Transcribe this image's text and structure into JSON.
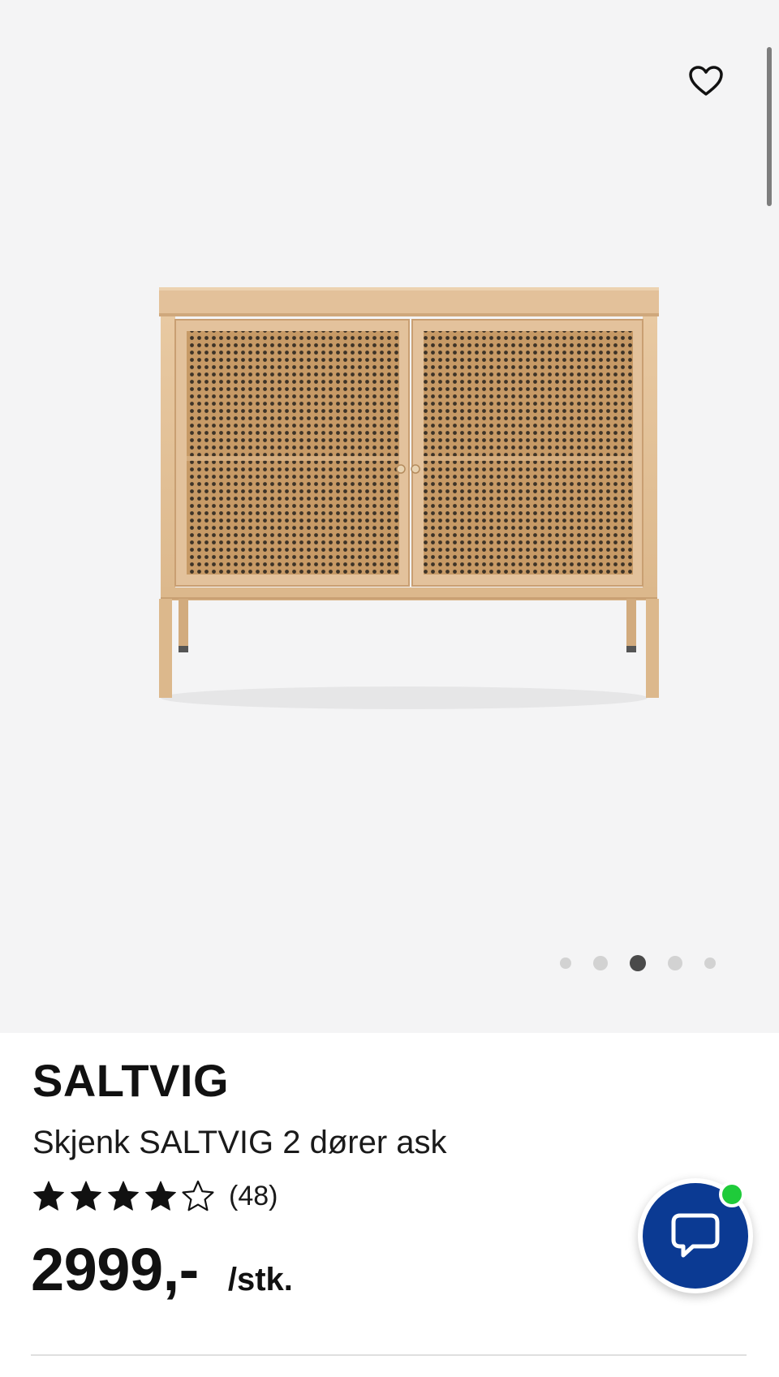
{
  "gallery": {
    "image_alt": "Skjenk SALTVIG 2 dører ask",
    "wishlist_icon": "heart-outline-icon",
    "dot_count": 5,
    "active_dot_index": 2,
    "colors": {
      "background": "#f4f4f5",
      "dot_active": "#4a4a4a",
      "dot_inactive": "#d2d2d2"
    }
  },
  "product": {
    "brand": "SALTVIG",
    "description": "Skjenk SALTVIG 2 dører ask",
    "rating": {
      "value": 4,
      "max": 5,
      "count_label": "(48)"
    },
    "price": "2999,-",
    "unit": "/stk."
  },
  "chat": {
    "icon": "chat-bubble-icon",
    "status": "online",
    "colors": {
      "button": "#0b3a93",
      "status": "#1fcb3a"
    }
  }
}
